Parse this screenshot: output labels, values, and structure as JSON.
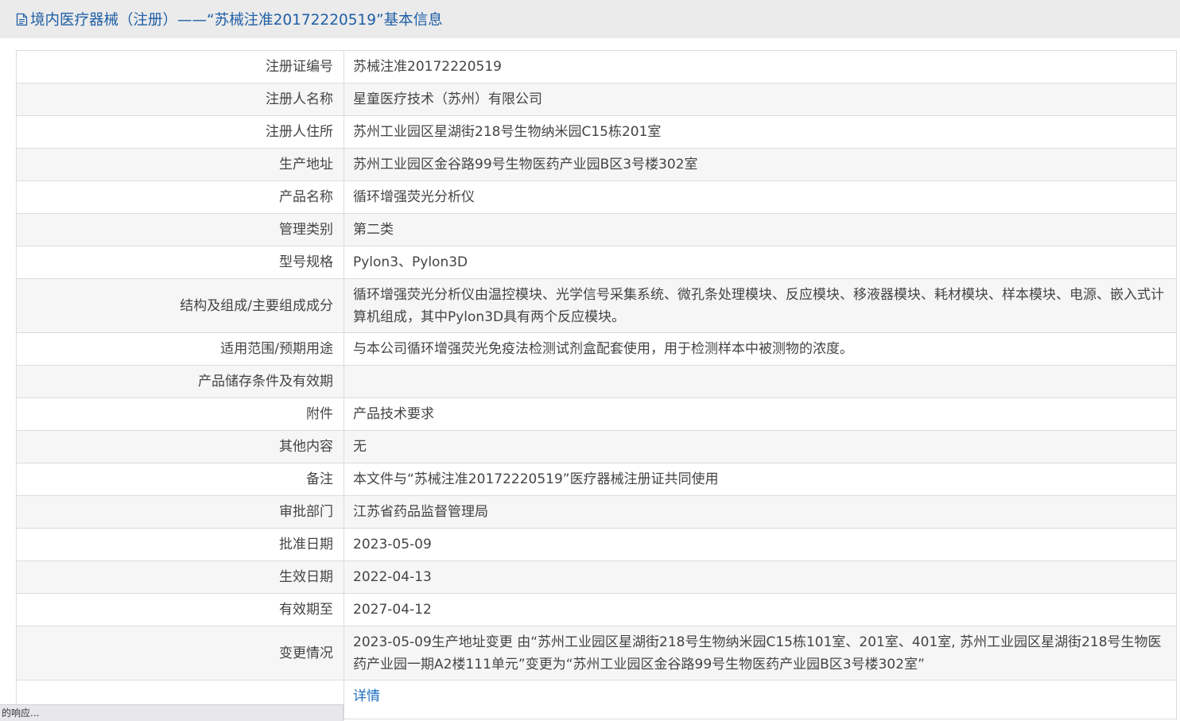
{
  "header": {
    "title": "境内医疗器械（注册）——“苏械注准20172220519”基本信息",
    "icon": "document-icon"
  },
  "rows": [
    {
      "label": "注册证编号",
      "value": "苏械注准20172220519"
    },
    {
      "label": "注册人名称",
      "value": "星童医疗技术（苏州）有限公司"
    },
    {
      "label": "注册人住所",
      "value": "苏州工业园区星湖街218号生物纳米园C15栋201室"
    },
    {
      "label": "生产地址",
      "value": "苏州工业园区金谷路99号生物医药产业园B区3号楼302室"
    },
    {
      "label": "产品名称",
      "value": "循环增强荧光分析仪"
    },
    {
      "label": "管理类别",
      "value": "第二类"
    },
    {
      "label": "型号规格",
      "value": "Pylon3、Pylon3D"
    },
    {
      "label": "结构及组成/主要组成成分",
      "value": "循环增强荧光分析仪由温控模块、光学信号采集系统、微孔条处理模块、反应模块、移液器模块、耗材模块、样本模块、电源、嵌入式计算机组成，其中Pylon3D具有两个反应模块。"
    },
    {
      "label": "适用范围/预期用途",
      "value": "与本公司循环增强荧光免疫法检测试剂盒配套使用，用于检测样本中被测物的浓度。"
    },
    {
      "label": "产品储存条件及有效期",
      "value": ""
    },
    {
      "label": "附件",
      "value": "产品技术要求"
    },
    {
      "label": "其他内容",
      "value": "无"
    },
    {
      "label": "备注",
      "value": "本文件与“苏械注准20172220519”医疗器械注册证共同使用"
    },
    {
      "label": "审批部门",
      "value": "江苏省药品监督管理局"
    },
    {
      "label": "批准日期",
      "value": "2023-05-09"
    },
    {
      "label": "生效日期",
      "value": "2022-04-13"
    },
    {
      "label": "有效期至",
      "value": "2027-04-12"
    },
    {
      "label": "变更情况",
      "value": "2023-05-09生产地址变更 由“苏州工业园区星湖街218号生物纳米园C15栋101室、201室、401室, 苏州工业园区星湖街218号生物医药产业园一期A2楼111单元”变更为“苏州工业园区金谷路99号生物医药产业园B区3号楼302室”"
    }
  ],
  "last_row": {
    "label": "",
    "link": "详情"
  },
  "status_bar": {
    "text": "的响应..."
  }
}
